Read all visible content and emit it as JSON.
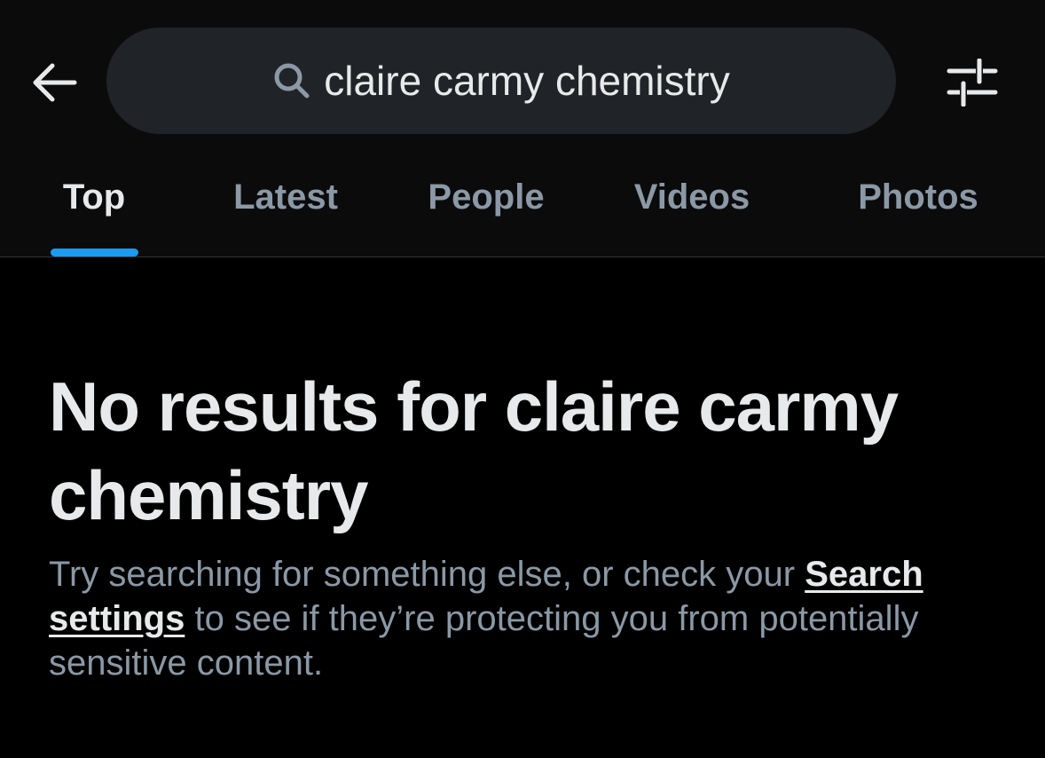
{
  "search": {
    "query": "claire carmy chemistry"
  },
  "icons": {
    "back": "arrow-left-icon",
    "search": "search-icon",
    "filter": "sliders-icon"
  },
  "tabs": [
    {
      "label": "Top",
      "active": true
    },
    {
      "label": "Latest",
      "active": false
    },
    {
      "label": "People",
      "active": false
    },
    {
      "label": "Videos",
      "active": false
    },
    {
      "label": "Photos",
      "active": false
    }
  ],
  "empty_state": {
    "title": "No results for claire carmy chemistry",
    "body_before_link": "Try searching for something else, or check your ",
    "link_label": "Search settings",
    "body_after_link": " to see if they’re protecting you from potentially sensitive content."
  },
  "colors": {
    "background": "#000000",
    "header_background": "#0b0b0c",
    "search_pill": "#202327",
    "accent": "#1d9bf0",
    "primary_text": "#e7e9ea",
    "secondary_text": "#8b98a5"
  }
}
